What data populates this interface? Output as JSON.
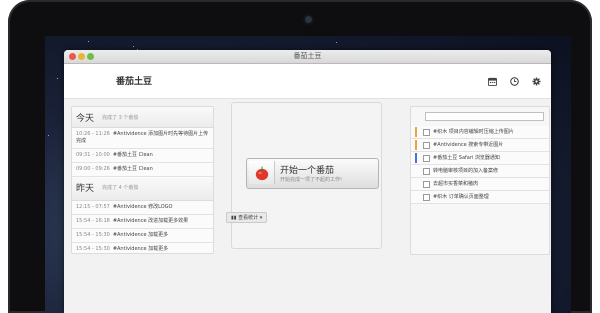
{
  "window": {
    "title": "番茄土豆"
  },
  "header": {
    "app_name": "番茄土豆"
  },
  "icons": [
    "calendar-icon",
    "clock-icon",
    "gear-icon",
    "tomato-icon",
    "chart-icon"
  ],
  "history": {
    "today": {
      "title": "今天",
      "subtitle": "完成了 3 个番茄",
      "items": [
        {
          "time": "10:26 - 11:26",
          "text": "#Antividence 添加图片时先等待图片上传完成"
        },
        {
          "time": "09:31 - 10:00",
          "text": "#番茄土豆 Clean"
        },
        {
          "time": "09:00 - 09:26",
          "text": "#番茄土豆 Clean"
        }
      ]
    },
    "yesterday": {
      "title": "昨天",
      "subtitle": "完成了 4 个番茄",
      "items": [
        {
          "time": "12:15 - 07:57",
          "text": "#Antividence 修改LOGO"
        },
        {
          "time": "15:54 - 16:18",
          "text": "#Antividence 改进加载更多效果"
        },
        {
          "time": "15:54 - 15:30",
          "text": "#Antividence 加载更多"
        },
        {
          "time": "15:54 - 15:30",
          "text": "#Antividence 加载更多"
        }
      ]
    }
  },
  "start": {
    "label": "开始一个番茄",
    "sub": "开始完成一项了不起的工作!"
  },
  "stats_button": "查看统计",
  "tasks": {
    "input_placeholder": "",
    "items": [
      {
        "text": "#织木 项目内容编辑时压缩上传图片",
        "color": "#f2a23a"
      },
      {
        "text": "#Antividence 搜索专带近图片",
        "color": "#f2a23a"
      },
      {
        "text": "#番茄土豆 Safari 浏览器通知",
        "color": "#4a73c9"
      },
      {
        "text": "转电脑审核项目的加入备案修",
        "color": ""
      },
      {
        "text": "去超市买香菜和猪肉",
        "color": ""
      },
      {
        "text": "#织木 订单确认页面整理",
        "color": ""
      }
    ]
  }
}
